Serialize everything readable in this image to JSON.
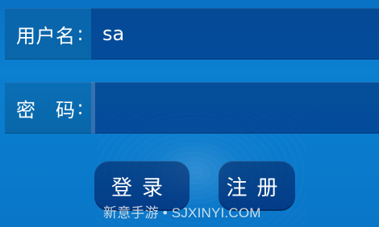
{
  "form": {
    "username_label": "用户名",
    "username_colon": ":",
    "username_value": "sa",
    "password_label": "密　码",
    "password_colon": ":",
    "password_value": ""
  },
  "buttons": {
    "login_label": "登录",
    "register_label": "注册"
  },
  "watermark": {
    "text": "新意手游 • SJXINYI.COM"
  }
}
